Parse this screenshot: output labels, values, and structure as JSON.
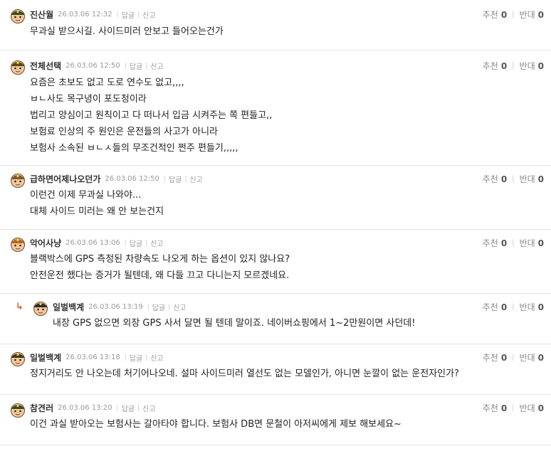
{
  "labels": {
    "reply": "답글",
    "report": "신고",
    "up": "추천",
    "down": "반대"
  },
  "comments": [
    {
      "nick": "진산월",
      "date": "26.03.06 12:32",
      "up": 0,
      "down": 0,
      "lines": [
        "무과실 받으시길. 사이드미러 안보고 들어오는건가"
      ]
    },
    {
      "nick": "전체선택",
      "date": "26.03.06 12:50",
      "up": 0,
      "down": 0,
      "lines": [
        "요즘은 초보도 없고 도로 연수도 없고,,,,",
        "ㅂㄴ사도 목구녕이 포도청이라",
        "법리고 양심이고 원칙이고 다 떠나서 입금 시켜주는 쪽 편들고,,",
        "보험료 인상의 주 원인은 운전들의 사고가 아니라",
        "보험사 소속된 ㅂㄴㅅ들의 무조건적인 쩐주 편들기,,,,,"
      ]
    },
    {
      "nick": "급하면어제나오던가",
      "date": "26.03.06 12:50",
      "up": 0,
      "down": 0,
      "lines": [
        "이런건 이제 무과실 나와야...",
        "대체 사이드 미러는 왜 안 보는건지"
      ]
    },
    {
      "nick": "악어사냥",
      "date": "26.03.06 13:06",
      "up": 0,
      "down": 0,
      "lines": [
        "블랙박스에 GPS 측정된 차량속도 나오게 하는 옵션이 있지 않나요?",
        "안전운전 했다는 증거가 될텐데, 왜 다들 끄고 다니는지 모르겠네요."
      ]
    },
    {
      "nick": "일벌백계",
      "date": "26.03.06 13:19",
      "up": 0,
      "down": 0,
      "reply": true,
      "lines": [
        "내장 GPS 없으면 외장 GPS 사서 달면 될 텐데 말이죠. 네이버쇼핑에서 1~2만원이면 사던데!"
      ]
    },
    {
      "nick": "일벌백계",
      "date": "26.03.06 13:18",
      "up": 0,
      "down": 0,
      "lines": [
        "정지거리도 안 나오는데 처기어나오네. 설마 사이드미러 열선도 없는 모델인가, 아니면 눈깔이 없는 운전자인가?"
      ]
    },
    {
      "nick": "참견러",
      "date": "26.03.06 13:20",
      "up": 0,
      "down": 0,
      "lines": [
        "이건 과실 받아오는 보험사는 갈아타야 합니다. 보험사 DB면 문철이 아저씨에게 제보 해보세요~"
      ]
    }
  ]
}
